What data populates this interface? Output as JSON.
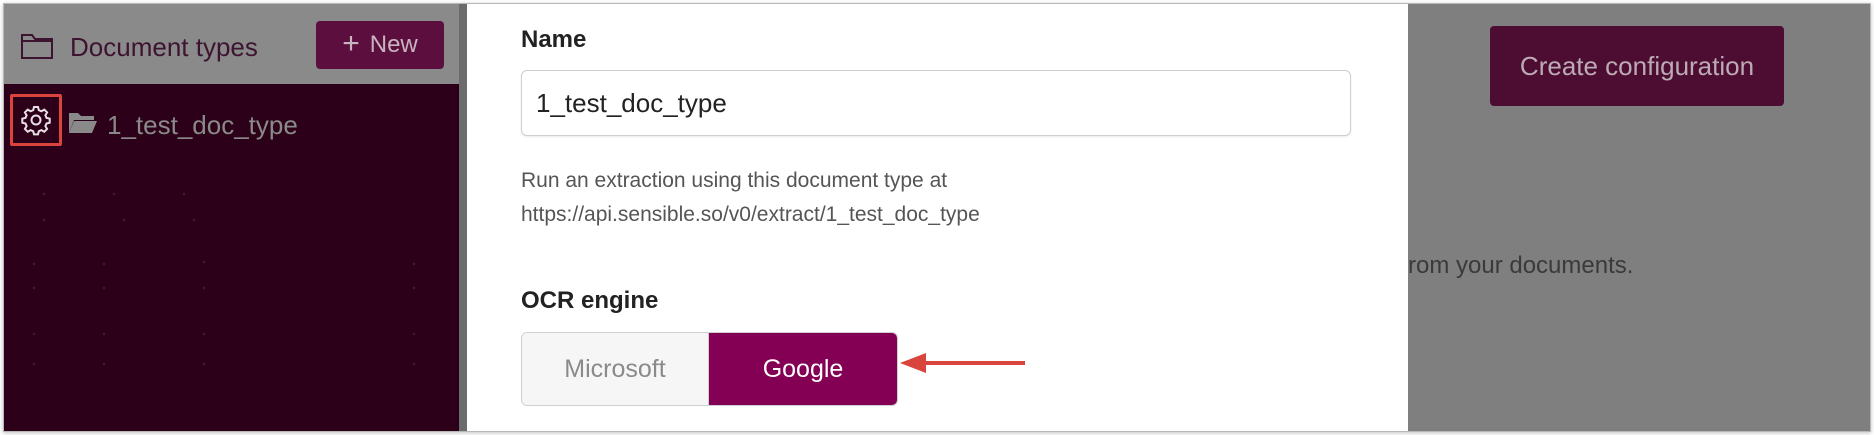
{
  "sidebar": {
    "title": "Document types",
    "new_button": {
      "icon": "plus-icon",
      "label": "New"
    },
    "tree": [
      {
        "icon": "open-folder-icon",
        "label": "1_test_doc_type"
      }
    ],
    "settings_icon": "gear-icon"
  },
  "main": {
    "create_button": "Create configuration",
    "background_text": "rom your documents."
  },
  "panel": {
    "name_label": "Name",
    "name_value": "1_test_doc_type",
    "help_line1": "Run an extraction using this document type at",
    "help_line2": "https://api.sensible.so/v0/extract/1_test_doc_type",
    "ocr_label": "OCR engine",
    "ocr_options": [
      "Microsoft",
      "Google"
    ],
    "ocr_selected": "Google"
  },
  "colors": {
    "brand": "#840054",
    "sidebar_dark": "#2d0019",
    "highlight_box": "#d9443c",
    "arrow": "#d9443c"
  }
}
